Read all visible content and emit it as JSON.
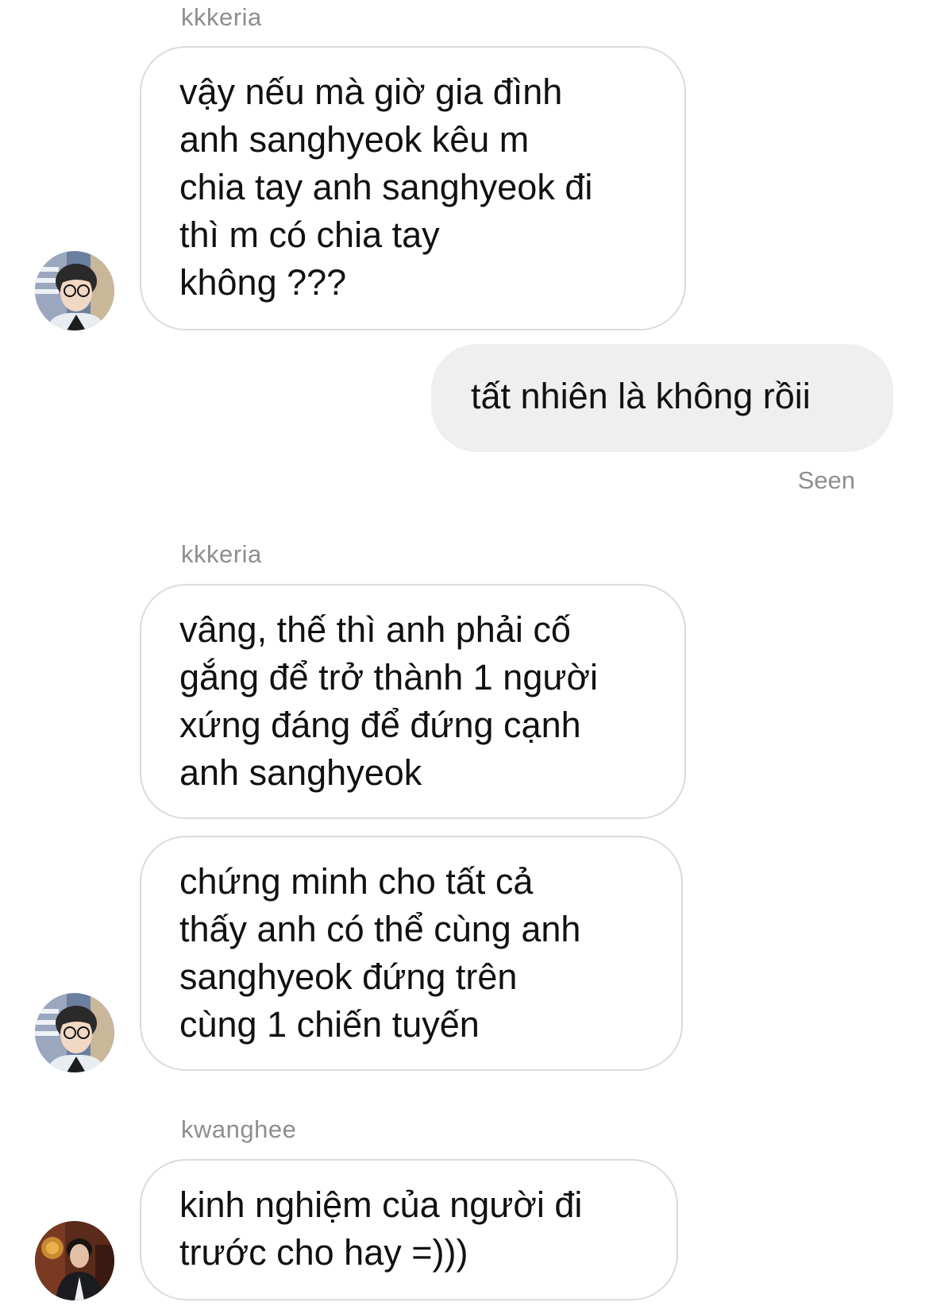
{
  "thread": {
    "group1": {
      "sender": "kkkeria",
      "messages": [
        "vậy nếu mà giờ gia đình\nanh sanghyeok kêu m\nchia tay anh sanghyeok đi\nthì m có chia tay\nkhông ???"
      ]
    },
    "outgoing": {
      "text": "tất nhiên là không rồii",
      "status": "Seen"
    },
    "group2": {
      "sender": "kkkeria",
      "messages": [
        "vâng, thế thì anh phải cố\ngắng để trở thành 1 người\nxứng đáng để đứng cạnh\nanh sanghyeok",
        "chứng minh cho tất cả\nthấy anh có thể cùng anh\nsanghyeok đứng trên\ncùng 1 chiến tuyến"
      ]
    },
    "group3": {
      "sender": "kwanghee",
      "messages": [
        "kinh nghiệm của người đi\ntrước cho hay =)))"
      ]
    }
  }
}
